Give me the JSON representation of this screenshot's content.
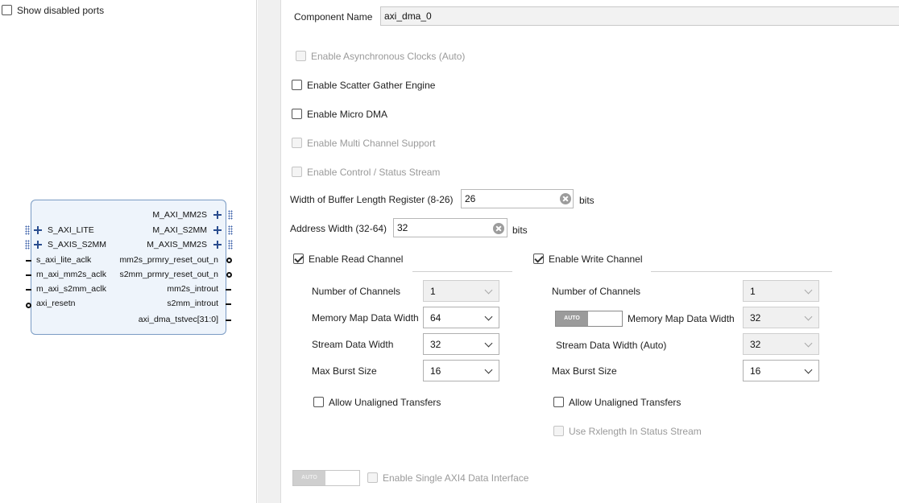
{
  "left": {
    "show_disabled_ports": {
      "label": "Show disabled ports",
      "checked": false
    },
    "block": {
      "left_ports": {
        "s_axi_lite": "S_AXI_LITE",
        "s_axis_s2mm": "S_AXIS_S2MM",
        "s_axi_lite_aclk": "s_axi_lite_aclk",
        "m_axi_mm2s_aclk": "m_axi_mm2s_aclk",
        "m_axi_s2mm_aclk": "m_axi_s2mm_aclk",
        "axi_resetn": "axi_resetn"
      },
      "right_ports": {
        "m_axi_mm2s": "M_AXI_MM2S",
        "m_axi_s2mm": "M_AXI_S2MM",
        "m_axis_mm2s": "M_AXIS_MM2S",
        "mm2s_prmry_reset_out_n": "mm2s_prmry_reset_out_n",
        "s2mm_prmry_reset_out_n": "s2mm_prmry_reset_out_n",
        "mm2s_introut": "mm2s_introut",
        "s2mm_introut": "s2mm_introut",
        "axi_dma_tstvec": "axi_dma_tstvec[31:0]"
      }
    }
  },
  "config": {
    "component_name_label": "Component Name",
    "component_name_value": "axi_dma_0",
    "enable_async_clocks": "Enable Asynchronous Clocks (Auto)",
    "enable_scatter_gather": "Enable Scatter Gather Engine",
    "enable_micro_dma": "Enable Micro DMA",
    "enable_multi_channel": "Enable Multi Channel Support",
    "enable_control_status": "Enable Control / Status Stream",
    "buffer_length_label": "Width of Buffer Length Register (8-26)",
    "buffer_length_value": "26",
    "buffer_length_unit": "bits",
    "address_width_label": "Address Width (32-64)",
    "address_width_value": "32",
    "address_width_unit": "bits",
    "read": {
      "enable_label": "Enable Read Channel",
      "num_channels_label": "Number of Channels",
      "num_channels_value": "1",
      "mm_data_width_label": "Memory Map Data Width",
      "mm_data_width_value": "64",
      "stream_width_label": "Stream Data Width",
      "stream_width_value": "32",
      "max_burst_label": "Max Burst Size",
      "max_burst_value": "16",
      "unaligned_label": "Allow Unaligned Transfers"
    },
    "write": {
      "enable_label": "Enable Write Channel",
      "num_channels_label": "Number of Channels",
      "num_channels_value": "1",
      "auto_toggle_text": "AUTO",
      "mm_data_width_label": "Memory Map Data Width",
      "mm_data_width_value": "32",
      "stream_width_label": "Stream Data Width (Auto)",
      "stream_width_value": "32",
      "max_burst_label": "Max Burst Size",
      "max_burst_value": "16",
      "unaligned_label": "Allow Unaligned Transfers",
      "rxlength_label": "Use Rxlength In Status Stream"
    },
    "single_axi4_toggle_text": "AUTO",
    "single_axi4_label": "Enable Single AXI4 Data Interface"
  }
}
